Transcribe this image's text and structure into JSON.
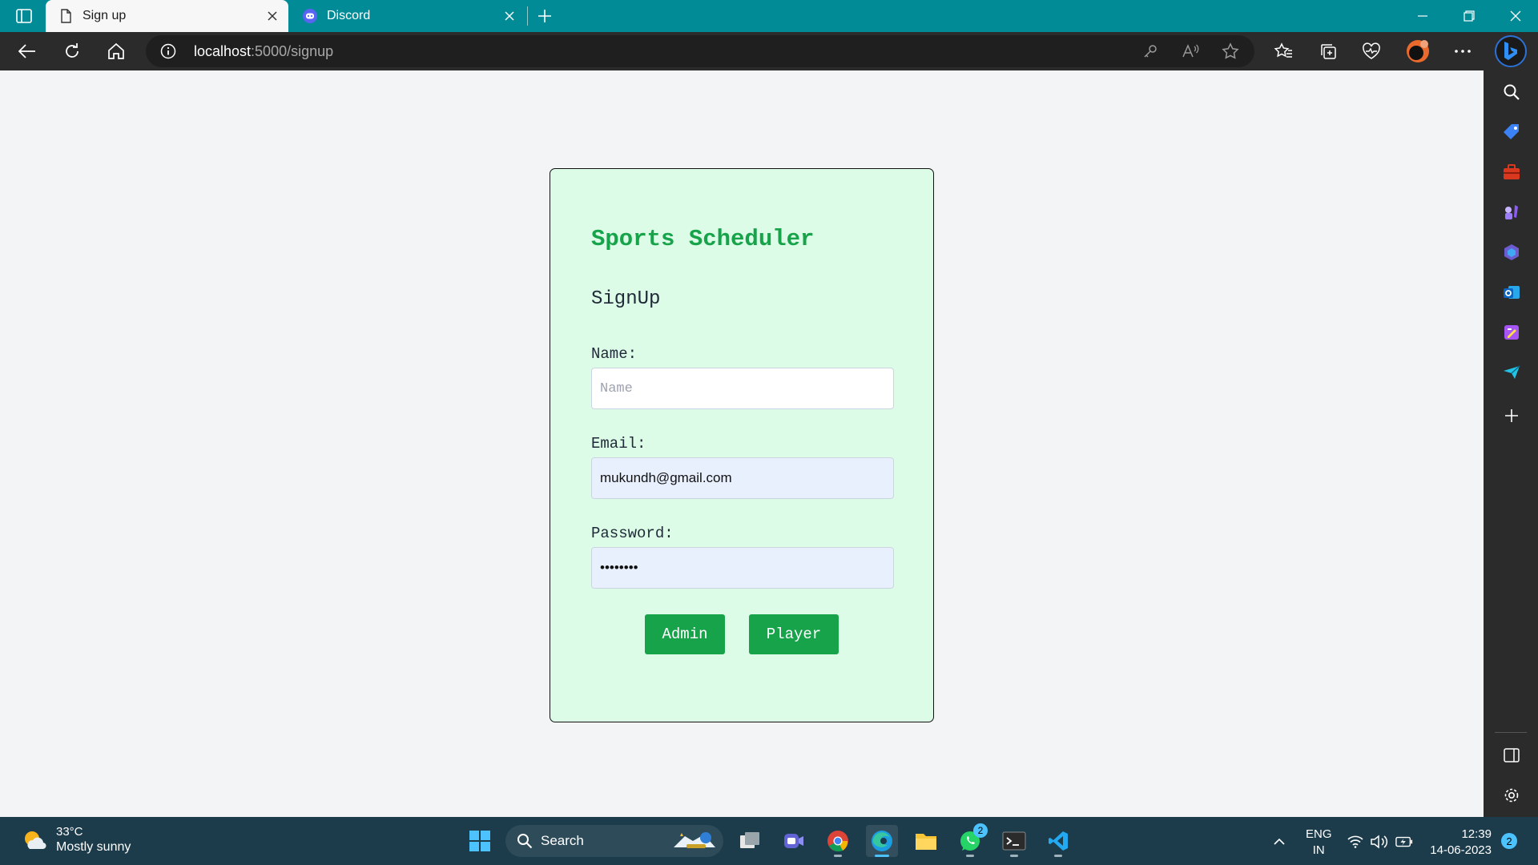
{
  "browser": {
    "tabs": [
      {
        "title": "Sign up",
        "active": true,
        "icon": "page-icon"
      },
      {
        "title": "Discord",
        "active": false,
        "icon": "discord-icon"
      }
    ],
    "address": {
      "host": "localhost",
      "path": ":5000/signup"
    },
    "accent": "#008b97"
  },
  "page": {
    "brand": "Sports Scheduler",
    "heading": "SignUp",
    "fields": [
      {
        "label": "Name:",
        "placeholder": "Name",
        "value": ""
      },
      {
        "label": "Email:",
        "placeholder": "",
        "value": "mukundh@gmail.com"
      },
      {
        "label": "Password:",
        "placeholder": "",
        "value": "••••••••"
      }
    ],
    "buttons": {
      "admin": "Admin",
      "player": "Player"
    },
    "colors": {
      "card_bg": "#dcfce7",
      "accent": "#16a34a",
      "page_bg": "#f3f4f6"
    }
  },
  "taskbar": {
    "weather": {
      "temp": "33°C",
      "desc": "Mostly sunny"
    },
    "search": "Search",
    "whatsapp_badge": "2",
    "lang": {
      "line1": "ENG",
      "line2": "IN"
    },
    "clock": {
      "time": "12:39",
      "date": "14-06-2023"
    },
    "notifications": "2"
  }
}
